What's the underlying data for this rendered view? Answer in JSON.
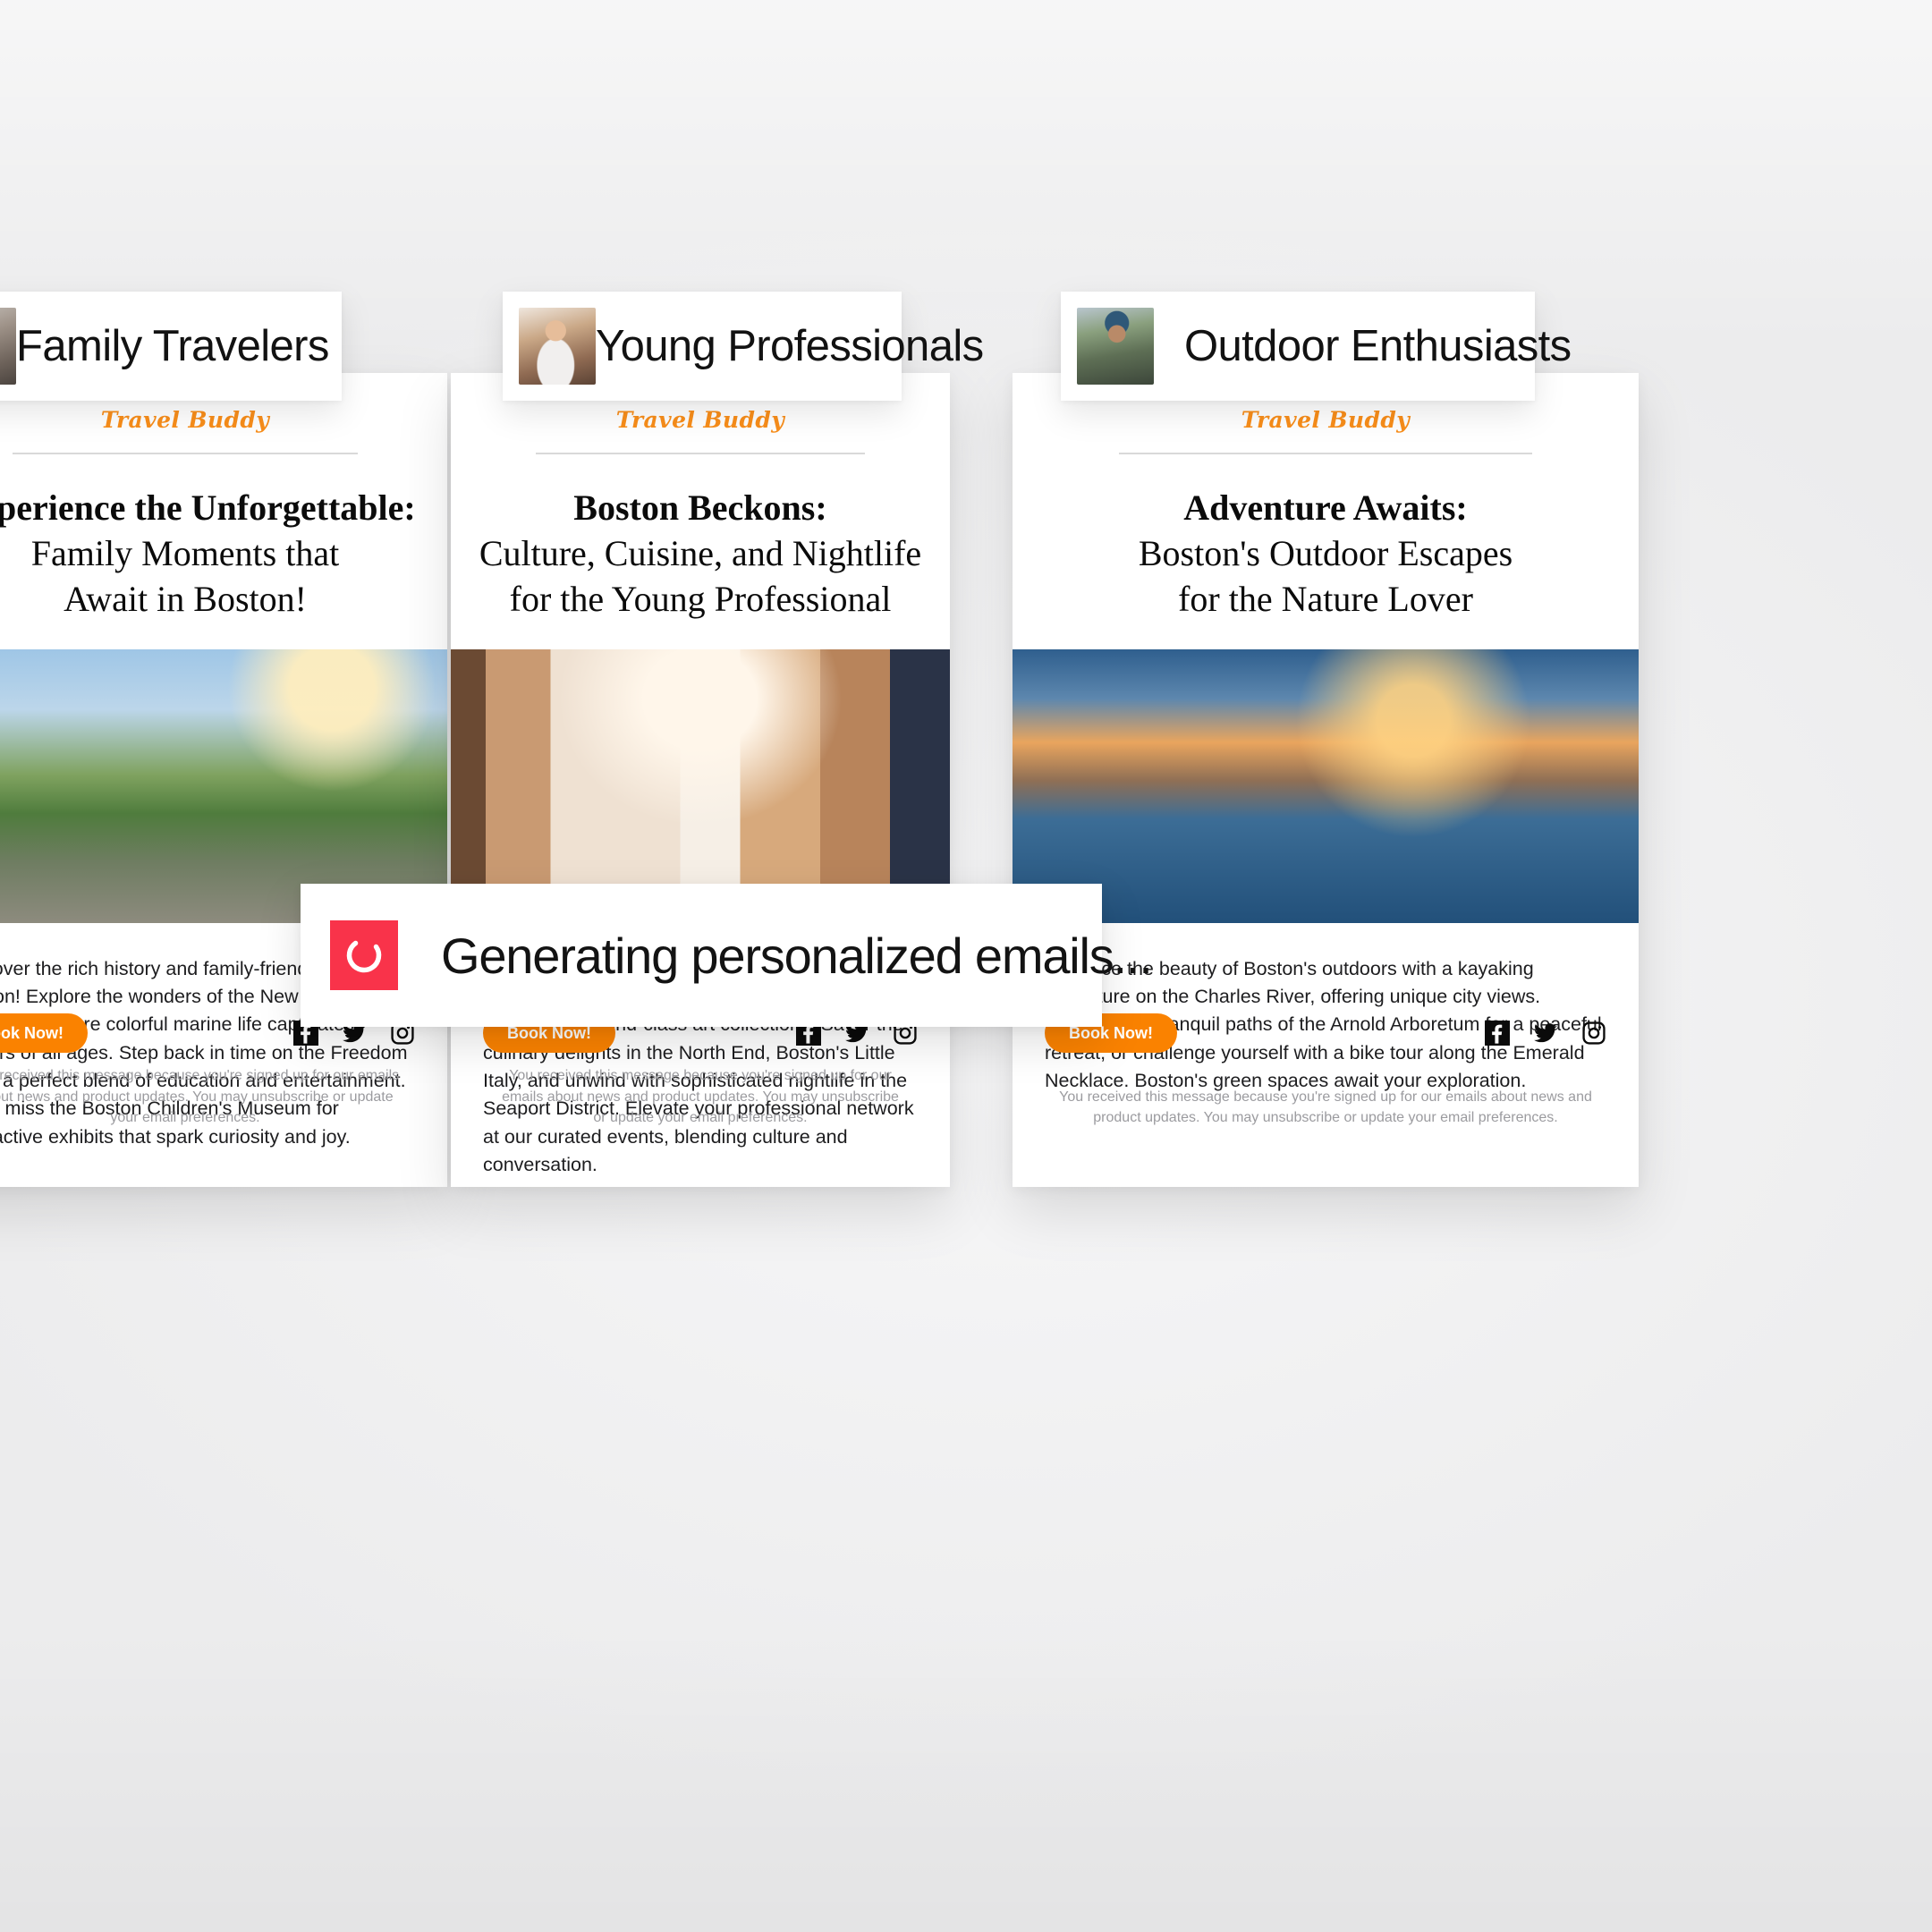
{
  "personas": [
    {
      "label": "Family Travelers",
      "avatar": "family-traveler-photo"
    },
    {
      "label": "Young Professionals",
      "avatar": "young-professional-photo"
    },
    {
      "label": "Outdoor Enthusiasts",
      "avatar": "outdoor-enthusiast-photo"
    }
  ],
  "brand": {
    "name": "Travel Buddy",
    "color": "#f98e1a"
  },
  "emails": [
    {
      "headline_line1": "Experience the Unforgettable:",
      "headline_line2": "Family Moments that",
      "headline_line3": "Await in Boston!",
      "hero": "boston-family-skyline-photo",
      "body": "Discover the rich history and family-friendly fun in Boston! Explore the wonders of the New England Aquarium, where colorful marine life captivates visitors of all ages. Step back in time on the Freedom Trail, a perfect blend of education and entertainment. Don't miss the Boston Children's Museum for interactive exhibits that spark curiosity and joy.",
      "cta": "Book Now!",
      "disclaimer": "You received this message because you're signed up for our emails about news and product updates. You may unsubscribe or update your email preferences."
    },
    {
      "headline_line1": "Boston Beckons:",
      "headline_line2": "Culture, Cuisine, and Nightlife",
      "headline_line3": "for the Young Professional",
      "hero": "museum-of-fine-arts-gallery-photo",
      "body": "Experience the vibrant life of Boston with exclusive tours of the Museum of Fine Arts, offering a glimpse into world-class art collections. Savor the culinary delights in the North End, Boston's Little Italy, and unwind with sophisticated nightlife in the Seaport District. Elevate your professional network at our curated events, blending culture and conversation.",
      "cta": "Book Now!",
      "disclaimer": "You received this message because you're signed up for our emails about news and product updates. You may unsubscribe or update your email preferences."
    },
    {
      "headline_line1": "Adventure Awaits:",
      "headline_line2": "Boston's Outdoor Escapes",
      "headline_line3": "for the Nature Lover",
      "hero": "charles-river-kayaking-photo",
      "body": "Embrace the beauty of Boston's outdoors with a kayaking adventure on the Charles River, offering unique city views. Discover the tranquil paths of the Arnold Arboretum for a peaceful retreat, or challenge yourself with a bike tour along the Emerald Necklace. Boston's green spaces await your exploration.",
      "cta": "Book Now!",
      "disclaimer": "You received this message because you're signed up for our emails about news and product updates. You may unsubscribe or update your email preferences."
    }
  ],
  "social": {
    "facebook": "facebook-icon",
    "twitter": "twitter-icon",
    "instagram": "instagram-icon"
  },
  "toast": {
    "message": "Generating personalized emails...",
    "spinner": "loading-spinner-icon",
    "accent_color": "#f9334a"
  }
}
